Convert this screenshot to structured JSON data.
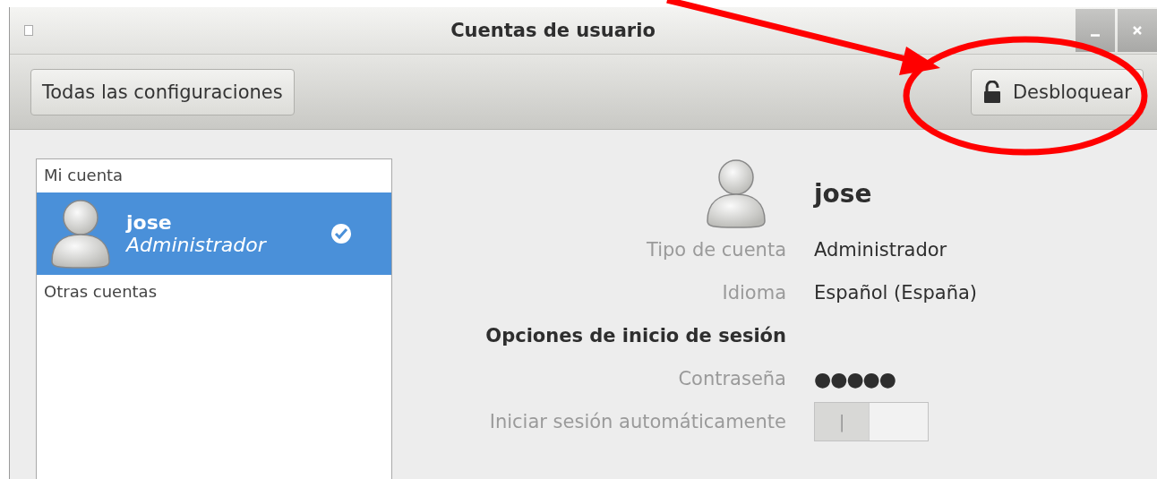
{
  "window": {
    "title": "Cuentas de usuario"
  },
  "toolbar": {
    "all_settings_button": "Todas las configuraciones",
    "unlock_button": "Desbloquear"
  },
  "accounts": {
    "my_account_header": "Mi cuenta",
    "items": [
      {
        "name": "jose",
        "role": "Administrador",
        "selected": true,
        "logged_in": true
      }
    ],
    "other_accounts_header": "Otras cuentas"
  },
  "details": {
    "name": "jose",
    "rows": [
      {
        "kind": "field",
        "label": "Tipo de cuenta",
        "value": "Administrador"
      },
      {
        "kind": "field",
        "label": "Idioma",
        "value": "Español (España)"
      },
      {
        "kind": "heading",
        "label": "Opciones de inicio de sesión"
      },
      {
        "kind": "field",
        "label": "Contraseña",
        "value": "●●●●●"
      },
      {
        "kind": "switch",
        "label": "Iniciar sesión automáticamente",
        "on": false,
        "switch_mark": "|"
      }
    ]
  }
}
